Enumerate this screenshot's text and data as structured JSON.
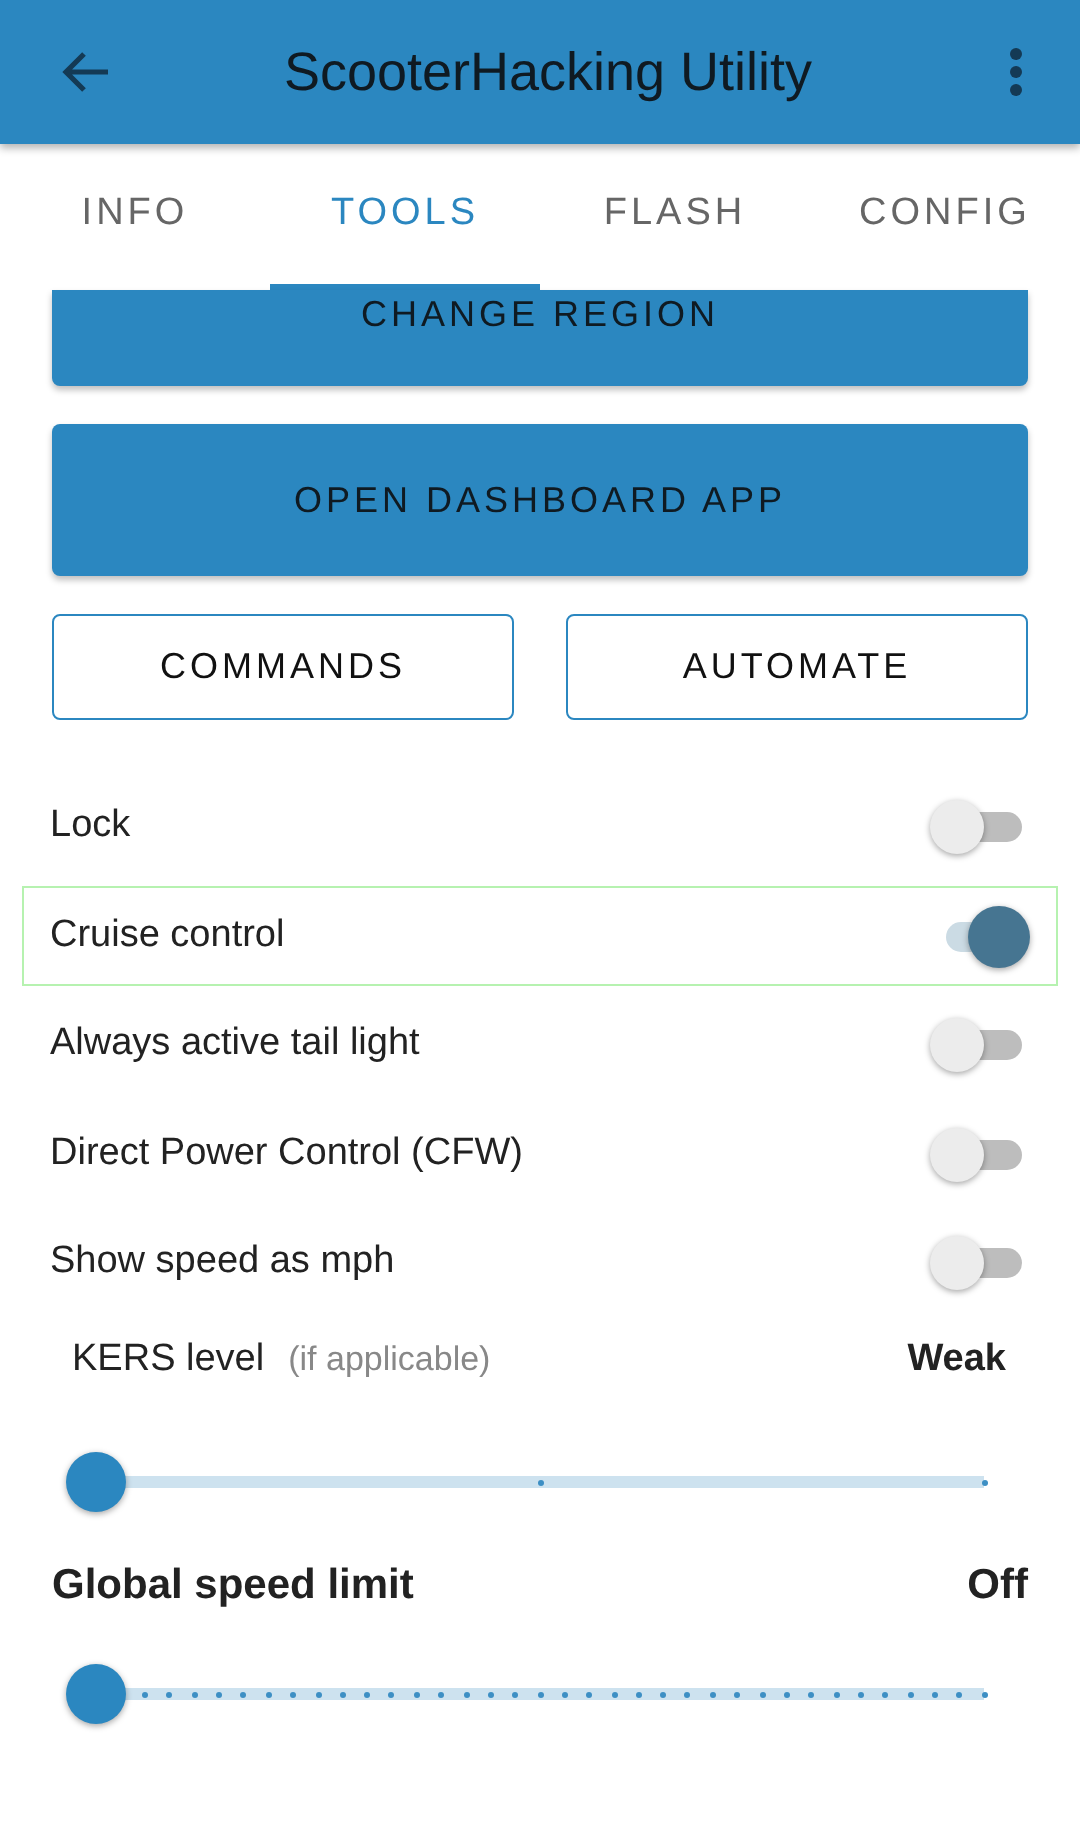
{
  "app_bar": {
    "title": "ScooterHacking Utility"
  },
  "tabs": [
    {
      "label": "INFO",
      "selected": false
    },
    {
      "label": "TOOLS",
      "selected": true
    },
    {
      "label": "FLASH",
      "selected": false
    },
    {
      "label": "CONFIG",
      "selected": false
    }
  ],
  "wide_buttons": [
    "CHANGE REGION",
    "OPEN DASHBOARD APP"
  ],
  "outline_buttons": [
    "COMMANDS",
    "AUTOMATE"
  ],
  "toggles": [
    {
      "label": "Lock",
      "on": false,
      "highlighted": false
    },
    {
      "label": "Cruise control",
      "on": true,
      "highlighted": true
    },
    {
      "label": "Always active tail light",
      "on": false,
      "highlighted": false
    },
    {
      "label": "Direct Power Control (CFW)",
      "on": false,
      "highlighted": false
    },
    {
      "label": "Show speed as mph",
      "on": false,
      "highlighted": false
    }
  ],
  "sliders": [
    {
      "kind": "coarse",
      "label": "KERS level",
      "hint": "(if applicable)",
      "reading": "Weak",
      "level": 0
    },
    {
      "kind": "fine",
      "label": "Global speed limit",
      "reading": "Off",
      "level": 0
    }
  ]
}
